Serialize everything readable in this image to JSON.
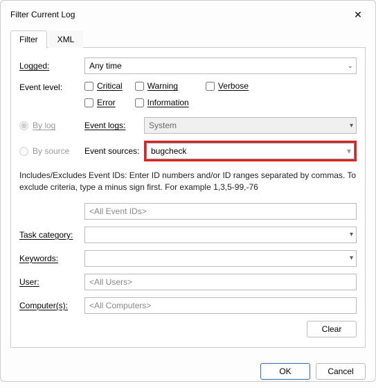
{
  "window": {
    "title": "Filter Current Log"
  },
  "tabs": {
    "filter": "Filter",
    "xml": "XML"
  },
  "labels": {
    "logged": "Logged:",
    "event_level": "Event level:",
    "by_log": "By log",
    "by_source": "By source",
    "event_logs": "Event logs:",
    "event_sources": "Event sources:",
    "task_category": "Task category:",
    "keywords": "Keywords:",
    "user": "User:",
    "computers": "Computer(s):"
  },
  "values": {
    "logged": "Any time",
    "event_logs": "System",
    "event_sources": "bugcheck",
    "event_ids": "<All Event IDs>",
    "task_category": "",
    "keywords": "",
    "user": "<All Users>",
    "computers": "<All Computers>"
  },
  "checkboxes": {
    "critical": "Critical",
    "warning": "Warning",
    "verbose": "Verbose",
    "error": "Error",
    "information": "Information"
  },
  "note": "Includes/Excludes Event IDs: Enter ID numbers and/or ID ranges separated by commas. To exclude criteria, type a minus sign first. For example 1,3,5-99,-76",
  "buttons": {
    "clear": "Clear",
    "ok": "OK",
    "cancel": "Cancel"
  }
}
